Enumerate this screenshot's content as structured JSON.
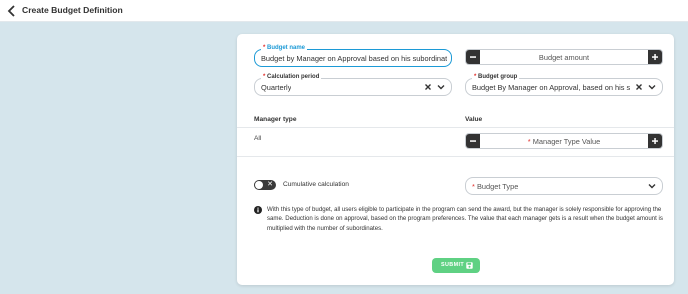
{
  "header": {
    "title": "Create Budget Definition"
  },
  "form": {
    "budget_name": {
      "label": "Budget name",
      "required": "*",
      "value": "Budget by Manager on Approval based on his subordinates"
    },
    "budget_amount": {
      "placeholder": "Budget amount"
    },
    "calculation_period": {
      "label": "Calculation period",
      "required": "*",
      "value": "Quarterly"
    },
    "budget_group": {
      "label": "Budget group",
      "required": "*",
      "value": "Budget By Manager on Approval, based on his s..."
    },
    "table": {
      "headers": [
        "Manager type",
        "Value"
      ],
      "rows": [
        {
          "manager_type": "All",
          "value_placeholder": "Manager Type Value",
          "required": "*"
        }
      ]
    },
    "cumulative": {
      "label": "Cumulative calculation",
      "checked": false
    },
    "budget_type": {
      "placeholder": "Budget Type",
      "required": "*"
    },
    "info": "With this type of budget, all users eligible to participate in the program can send the award, but the manager is solely responsible for approving the same. Deduction is done on approval, based on the program preferences. The value that each manager gets is a result when the budget amount is multiplied with the number of subordinates.",
    "submit_label": "SUBMIT"
  },
  "icons": {
    "back": "chevron-left-icon",
    "clear": "close-icon",
    "dropdown": "chevron-down-icon",
    "minus": "minus-icon",
    "plus": "plus-icon",
    "info": "info-icon",
    "save": "save-icon"
  },
  "colors": {
    "accent": "#f2c200",
    "focus": "#1c9ad6",
    "submit": "#5fd183",
    "required": "#e02b27",
    "background": "#d5e5ec"
  }
}
